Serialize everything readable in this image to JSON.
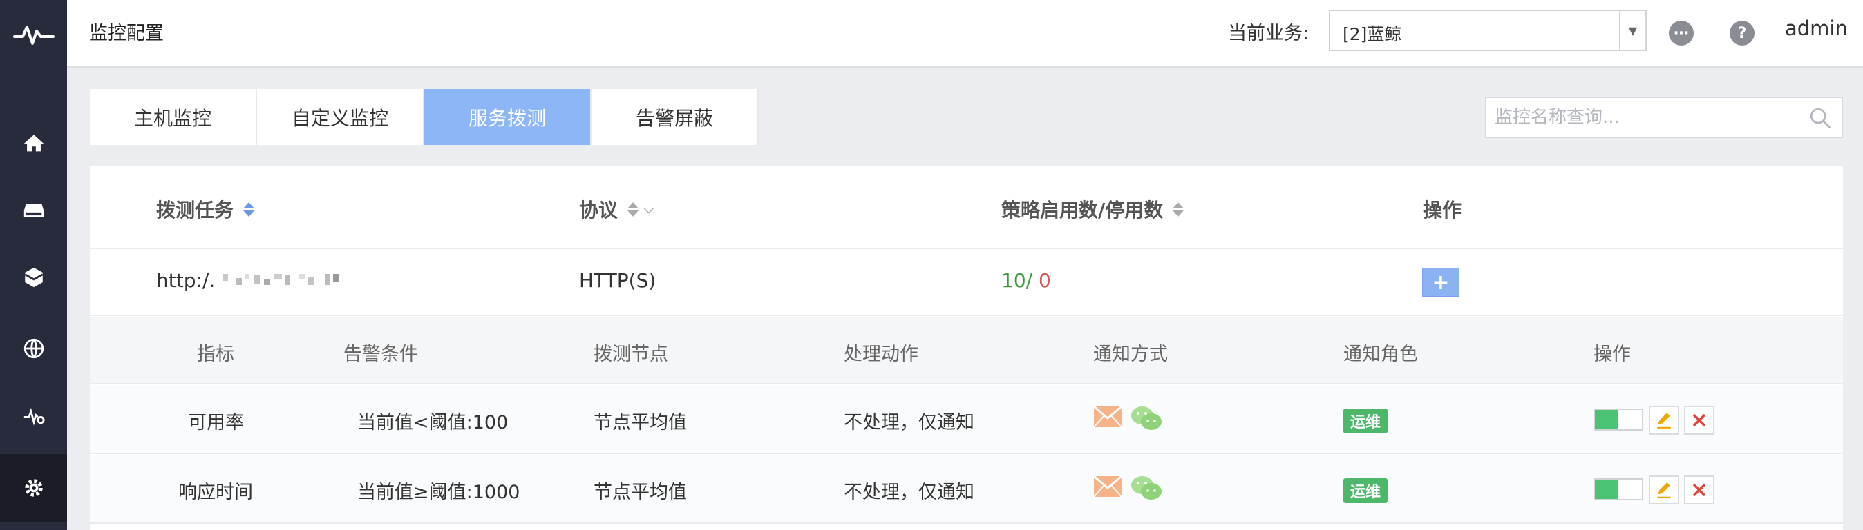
{
  "header": {
    "title": "监控配置",
    "business_label": "当前业务:",
    "business_value": "[2]蓝鲸",
    "admin": "admin"
  },
  "sidebar": {
    "items": [
      {
        "icon": "home-icon"
      },
      {
        "icon": "server-icon"
      },
      {
        "icon": "box-icon"
      },
      {
        "icon": "globe-icon"
      },
      {
        "icon": "monitor-pulse-icon"
      },
      {
        "icon": "gear-icon",
        "active": true
      }
    ]
  },
  "tabs": [
    {
      "label": "主机监控"
    },
    {
      "label": "自定义监控"
    },
    {
      "label": "服务拨测",
      "active": true
    },
    {
      "label": "告警屏蔽"
    }
  ],
  "search": {
    "placeholder": "监控名称查询..."
  },
  "table": {
    "headers": {
      "task": "拨测任务",
      "protocol": "协议",
      "strategy": "策略启用数/停用数",
      "actions": "操作"
    },
    "task_row": {
      "url": "http:/.",
      "protocol": "HTTP(S)",
      "enabled": "10/",
      "disabled": " 0",
      "add_label": "+"
    },
    "sub_headers": {
      "metric": "指标",
      "condition": "告警条件",
      "node": "拨测节点",
      "action": "处理动作",
      "notify": "通知方式",
      "role": "通知角色",
      "ops": "操作"
    },
    "sub_rows": [
      {
        "metric": "可用率",
        "condition": "当前值<阈值:100",
        "node": "节点平均值",
        "action": "不处理，仅通知",
        "role": "运维",
        "toggle_level": 0.5
      },
      {
        "metric": "响应时间",
        "condition": "当前值≥阈值:1000",
        "node": "节点平均值",
        "action": "不处理，仅通知",
        "role": "运维",
        "toggle_level": 0.5
      }
    ]
  },
  "colors": {
    "sidebar": "#282b3b",
    "tab_active": "#8db6f6",
    "enabled": "#3a9a3a",
    "disabled": "#d9534f",
    "badge": "#4db86a"
  }
}
